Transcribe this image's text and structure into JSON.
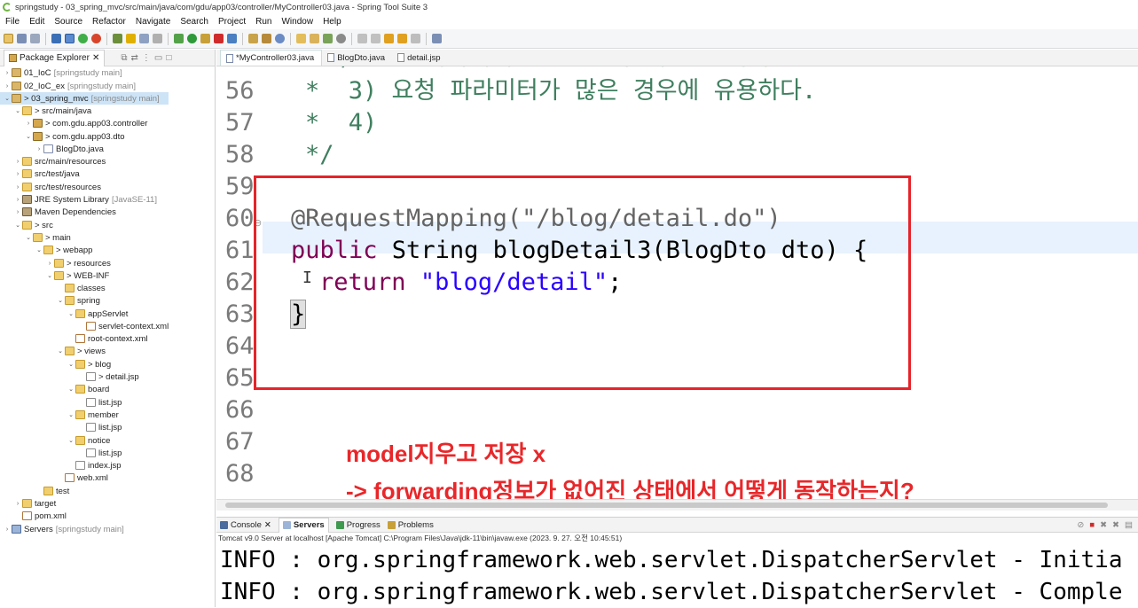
{
  "window": {
    "title": "springstudy - 03_spring_mvc/src/main/java/com/gdu/app03/controller/MyController03.java - Spring Tool Suite 3"
  },
  "menu": [
    "File",
    "Edit",
    "Source",
    "Refactor",
    "Navigate",
    "Search",
    "Project",
    "Run",
    "Window",
    "Help"
  ],
  "explorer": {
    "tab_label": "Package Explorer",
    "items": [
      {
        "label": "01_IoC",
        "dec": "[springstudy main]"
      },
      {
        "label": "02_IoC_ex",
        "dec": "[springstudy main]"
      },
      {
        "label": "> 03_spring_mvc",
        "dec": "[springstudy main]"
      },
      {
        "label": "> src/main/java",
        "dec": ""
      },
      {
        "label": "> com.gdu.app03.controller",
        "dec": ""
      },
      {
        "label": "> com.gdu.app03.dto",
        "dec": ""
      },
      {
        "label": "BlogDto.java",
        "dec": ""
      },
      {
        "label": "src/main/resources",
        "dec": ""
      },
      {
        "label": "src/test/java",
        "dec": ""
      },
      {
        "label": "src/test/resources",
        "dec": ""
      },
      {
        "label": "JRE System Library",
        "dec": "[JavaSE-11]"
      },
      {
        "label": "Maven Dependencies",
        "dec": ""
      },
      {
        "label": "> src",
        "dec": ""
      },
      {
        "label": "> main",
        "dec": ""
      },
      {
        "label": "> webapp",
        "dec": ""
      },
      {
        "label": "> resources",
        "dec": ""
      },
      {
        "label": "> WEB-INF",
        "dec": ""
      },
      {
        "label": "classes",
        "dec": ""
      },
      {
        "label": "spring",
        "dec": ""
      },
      {
        "label": "appServlet",
        "dec": ""
      },
      {
        "label": "servlet-context.xml",
        "dec": ""
      },
      {
        "label": "root-context.xml",
        "dec": ""
      },
      {
        "label": "> views",
        "dec": ""
      },
      {
        "label": "> blog",
        "dec": ""
      },
      {
        "label": "> detail.jsp",
        "dec": ""
      },
      {
        "label": "board",
        "dec": ""
      },
      {
        "label": "list.jsp",
        "dec": ""
      },
      {
        "label": "member",
        "dec": ""
      },
      {
        "label": "list.jsp",
        "dec": ""
      },
      {
        "label": "notice",
        "dec": ""
      },
      {
        "label": "list.jsp",
        "dec": ""
      },
      {
        "label": "index.jsp",
        "dec": ""
      },
      {
        "label": "web.xml",
        "dec": ""
      },
      {
        "label": "test",
        "dec": ""
      },
      {
        "label": "target",
        "dec": ""
      },
      {
        "label": "pom.xml",
        "dec": ""
      },
      {
        "label": "Servers",
        "dec": "[springstudy main]"
      }
    ]
  },
  "editor": {
    "tabs": [
      "*MyController03.java",
      "BlogDto.java",
      "detail.jsp"
    ],
    "line_numbers": [
      "56",
      "57",
      "58",
      "59",
      "60",
      "61",
      "62",
      "63",
      "64",
      "65",
      "66",
      "67",
      "68"
    ],
    "code": {
      "l56": "*  3) 요청 파라미터가 많은 경우에 유용하다.",
      "l57": "*  4)",
      "l58": "*/",
      "l60": "@RequestMapping(\"/blog/detail.do\")",
      "l61_kw": "public",
      "l61_rest": " String blogDetail3(BlogDto dto) {",
      "l62_kw": "return",
      "l62_str": "\"blog/detail\"",
      "l62_end": ";",
      "l63": "}"
    }
  },
  "annotation": {
    "line1": "model지우고 저장 x",
    "line2": "-> forwarding정보가 없어진 상태에서 어떻게 동작하는지?"
  },
  "console": {
    "tabs": [
      "Console",
      "Servers",
      "Progress",
      "Problems"
    ],
    "description": "Tomcat v9.0 Server at localhost [Apache Tomcat] C:\\Program Files\\Java\\jdk-11\\bin\\javaw.exe  (2023. 9. 27. 오전 10:45:51)",
    "lines": [
      "INFO : org.springframework.web.servlet.DispatcherServlet - Initia",
      "INFO : org.springframework.web.servlet.DispatcherServlet - Comple"
    ]
  }
}
